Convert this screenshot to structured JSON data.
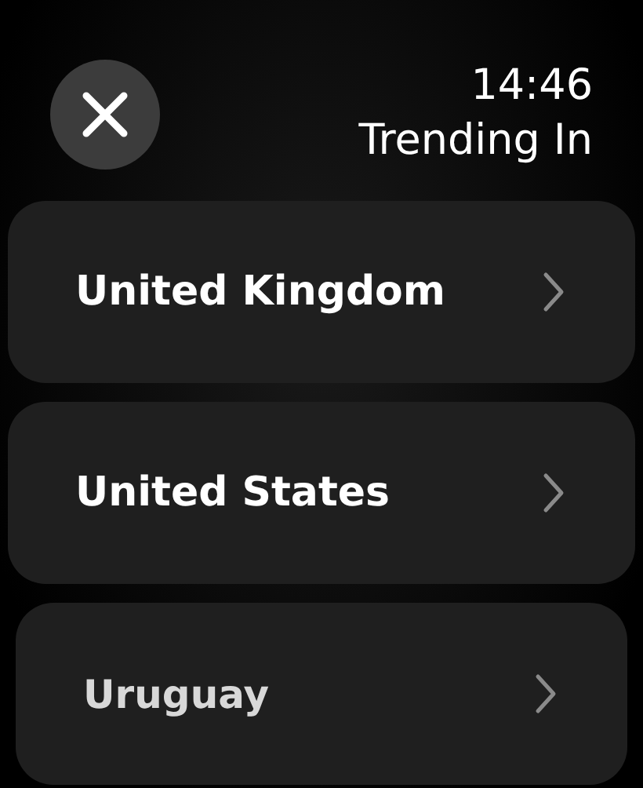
{
  "header": {
    "time": "14:46",
    "title": "Trending In"
  },
  "countries": [
    {
      "name": "United Kingdom"
    },
    {
      "name": "United States"
    },
    {
      "name": "Uruguay"
    }
  ]
}
